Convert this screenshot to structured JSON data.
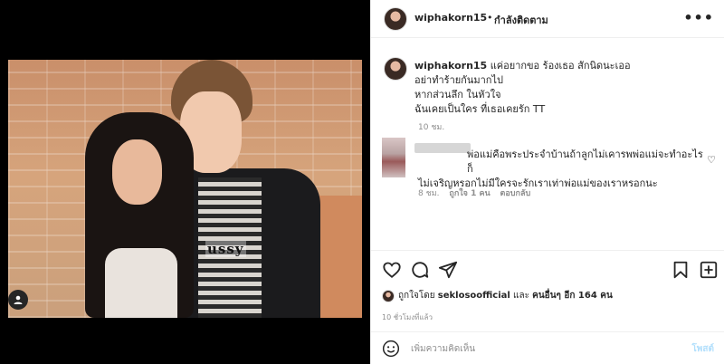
{
  "header": {
    "username": "wiphakorn15",
    "separator": "•",
    "follow_status": "กำลังติดตาม",
    "more_icon": "more-icon"
  },
  "photo": {
    "shirt_text": "ussy",
    "tag_icon": "user-tag-icon"
  },
  "caption": {
    "username": "wiphakorn15",
    "lines": [
      "แค่อยากขอ ร้องเธอ สักนิดนะเออ",
      "อย่าทำร้ายกันมากไป",
      "หากส่วนลึก ในหัวใจ",
      "ฉันเคยเป็นใคร ที่เธอเคยรัก TT"
    ],
    "time": "10 ชม."
  },
  "comment": {
    "line1": "พ่อแม่คือพระประจำบ้านถ้าลูกไม่เคารพพ่อแม่จะทำอะไรก็",
    "line2": "ไม่เจริญหรอกไม่มีใครจะรักเราเท่าพ่อแม่ของเราหรอกนะ",
    "time": "8 ชม.",
    "likes": "ถูกใจ 1 คน",
    "reply": "ตอบกลับ"
  },
  "actions": {
    "like_icon": "heart-icon",
    "comment_icon": "comment-icon",
    "share_icon": "share-icon",
    "save_icon": "bookmark-icon"
  },
  "likes": {
    "prefix": "ถูกใจโดย",
    "user": "seklosoofficial",
    "middle": "และ",
    "others": "คนอื่นๆ อีก 164 คน"
  },
  "post_time": "10 ชั่วโมงที่แล้ว",
  "composer": {
    "placeholder": "เพิ่มความคิดเห็น",
    "post_label": "โพสต์"
  },
  "colors": {
    "text": "#262626",
    "secondary": "#8e8e8e",
    "post_disabled": "#b2dffc",
    "border": "#efefef"
  }
}
